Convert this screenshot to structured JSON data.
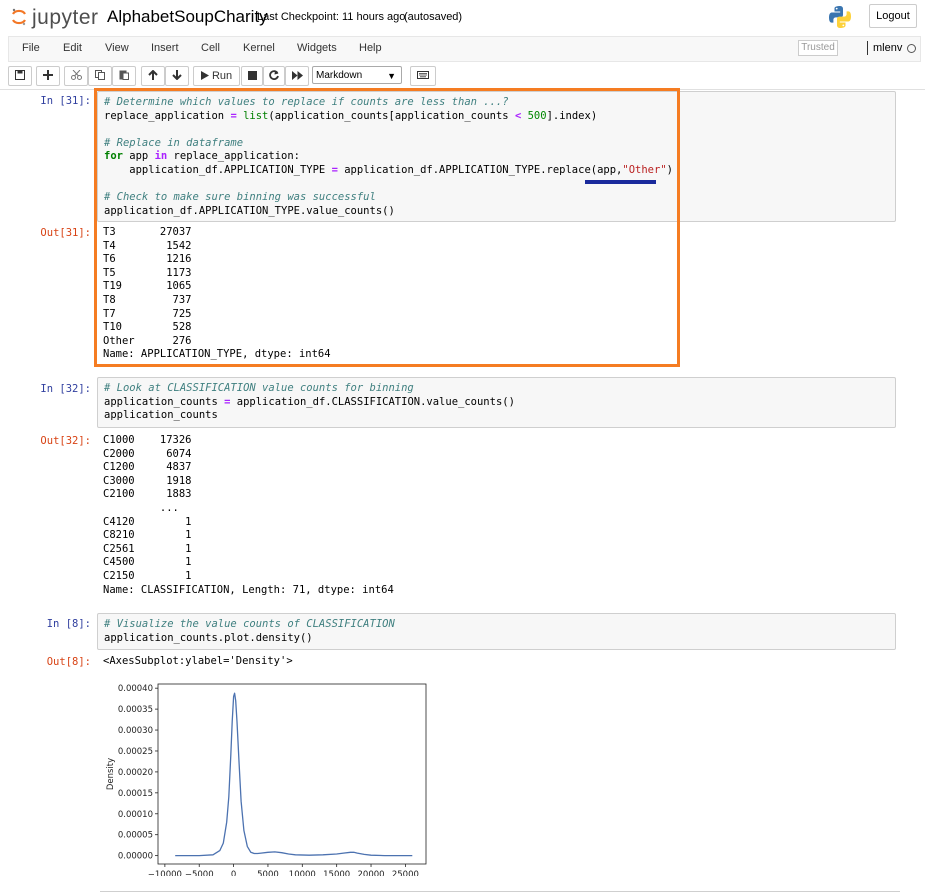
{
  "header": {
    "logo_text": "jupyter",
    "notebook_name": "AlphabetSoupCharity",
    "checkpoint": "Last Checkpoint: 11 hours ago",
    "autosave": "(autosaved)",
    "logout_label": "Logout"
  },
  "menu": {
    "items": [
      "File",
      "Edit",
      "View",
      "Insert",
      "Cell",
      "Kernel",
      "Widgets",
      "Help"
    ],
    "trusted": "Trusted",
    "kernel": "mlenv"
  },
  "toolbar": {
    "run_label": "Run",
    "cell_type": "Markdown",
    "icons": [
      "save-icon",
      "plus-icon",
      "cut-icon",
      "copy-icon",
      "paste-icon",
      "arrow-up-icon",
      "arrow-down-icon",
      "run-icon",
      "stop-icon",
      "restart-icon",
      "fast-forward-icon",
      "keyboard-icon"
    ]
  },
  "cells": [
    {
      "prompt_in": "In [31]:",
      "code": [
        "# Determine which values to replace if counts are less than ...?",
        "replace_application = list(application_counts[application_counts < 500].index)",
        "",
        "# Replace in dataframe",
        "for app in replace_application:",
        "    application_df.APPLICATION_TYPE = application_df.APPLICATION_TYPE.replace(app,\"Other\")",
        "",
        "# Check to make sure binning was successful",
        "application_df.APPLICATION_TYPE.value_counts()"
      ],
      "prompt_out": "Out[31]:",
      "output": "T3       27037\nT4        1542\nT6        1216\nT5        1173\nT19       1065\nT8         737\nT7         725\nT10        528\nOther      276\nName: APPLICATION_TYPE, dtype: int64"
    },
    {
      "prompt_in": "In [32]:",
      "code": [
        "# Look at CLASSIFICATION value counts for binning",
        "application_counts = application_df.CLASSIFICATION.value_counts()",
        "application_counts"
      ],
      "prompt_out": "Out[32]:",
      "output": "C1000    17326\nC2000     6074\nC1200     4837\nC3000     1918\nC2100     1883\n         ...  \nC4120        1\nC8210        1\nC2561        1\nC4500        1\nC2150        1\nName: CLASSIFICATION, Length: 71, dtype: int64"
    },
    {
      "prompt_in": "In [8]:",
      "code": [
        "# Visualize the value counts of CLASSIFICATION",
        "application_counts.plot.density()"
      ],
      "prompt_out": "Out[8]:",
      "output": "<AxesSubplot:ylabel='Density'>"
    }
  ],
  "chart_data": {
    "type": "line",
    "title": "",
    "xlabel": "",
    "ylabel": "Density",
    "xlim": [
      -11000,
      28000
    ],
    "ylim": [
      -2e-05,
      0.00041
    ],
    "xticks": [
      -10000,
      -5000,
      0,
      5000,
      10000,
      15000,
      20000,
      25000
    ],
    "xtick_labels": [
      "−10000",
      "−5000",
      "0",
      "5000",
      "10000",
      "15000",
      "20000",
      "25000"
    ],
    "yticks": [
      0,
      5e-05,
      0.0001,
      0.00015,
      0.0002,
      0.00025,
      0.0003,
      0.00035,
      0.0004
    ],
    "ytick_labels": [
      "0.00000",
      "0.00005",
      "0.00010",
      "0.00015",
      "0.00020",
      "0.00025",
      "0.00030",
      "0.00035",
      "0.00040"
    ],
    "grid": false,
    "color": "#4c72b0",
    "series": [
      {
        "x": [
          -8500,
          -5000,
          -3000,
          -2000,
          -1500,
          -1000,
          -700,
          -400,
          -200,
          0,
          150,
          300,
          500,
          800,
          1100,
          1500,
          2000,
          2500,
          3000,
          3500,
          4000,
          5000,
          6000,
          7000,
          8000,
          9000,
          11000,
          13000,
          15000,
          16000,
          17000,
          17500,
          18000,
          19000,
          20000,
          22000,
          24000,
          26000
        ],
        "y": [
          0,
          0,
          2e-06,
          1.2e-05,
          3e-05,
          8e-05,
          0.00014,
          0.00024,
          0.00032,
          0.00038,
          0.000388,
          0.00037,
          0.00032,
          0.00022,
          0.00013,
          6e-05,
          2.2e-05,
          8e-06,
          5e-06,
          5e-06,
          6e-06,
          8e-06,
          9e-06,
          7e-06,
          4e-06,
          2e-06,
          1e-06,
          2e-06,
          4e-06,
          6e-06,
          8e-06,
          8e-06,
          6e-06,
          3e-06,
          1e-06,
          0,
          0,
          0
        ]
      }
    ]
  }
}
